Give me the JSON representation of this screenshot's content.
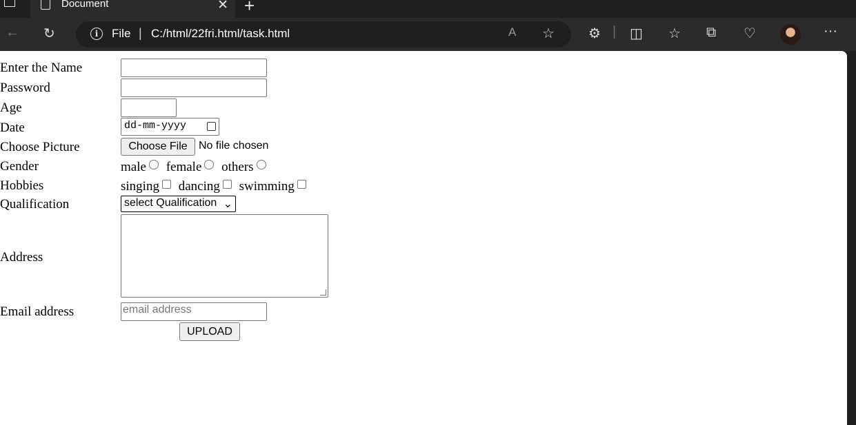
{
  "browser": {
    "tab_title": "Document",
    "address": {
      "scheme": "File",
      "url": "C:/html/22fri.html/task.html"
    }
  },
  "form": {
    "labels": {
      "name": "Enter the Name",
      "password": "Password",
      "age": "Age",
      "date": "Date",
      "picture": "Choose Picture",
      "gender": "Gender",
      "hobbies": "Hobbies",
      "qualification": "Qualification",
      "address": "Address",
      "email": "Email address"
    },
    "date_placeholder": "dd-mm-yyyy",
    "file_button": "Choose File",
    "file_status": "No file chosen",
    "gender_options": [
      "male",
      "female",
      "others"
    ],
    "hobby_options": [
      "singing",
      "dancing",
      "swimming"
    ],
    "qualification_selected": "select Qualification",
    "email_placeholder": "email address",
    "submit_label": "UPLOAD"
  }
}
